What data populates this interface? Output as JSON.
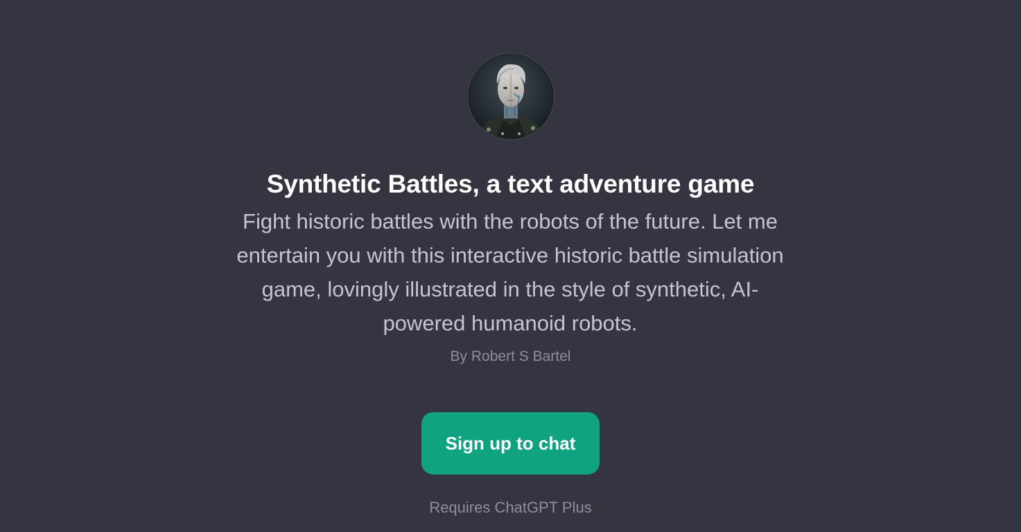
{
  "gpt": {
    "avatar_icon": "robot-portrait-icon",
    "title": "Synthetic Battles, a text adventure game",
    "description": "Fight historic battles with the robots of the future. Let me entertain you with this interactive historic battle simulation game, lovingly illustrated in the style of synthetic, AI-powered humanoid robots.",
    "author": "By Robert S Bartel"
  },
  "actions": {
    "signup_label": "Sign up to chat",
    "requirement_note": "Requires ChatGPT Plus"
  },
  "colors": {
    "background": "#343541",
    "accent": "#10a37f",
    "title": "#ffffff",
    "body_text": "#c5c5d2",
    "muted_text": "#8e8ea0"
  }
}
